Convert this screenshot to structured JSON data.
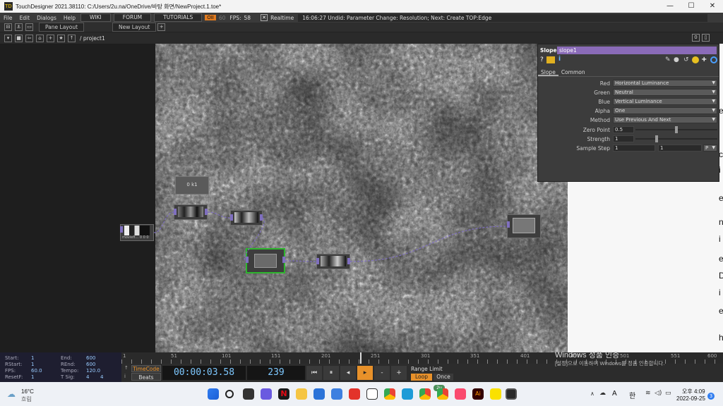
{
  "window": {
    "title": "TouchDesigner 2021.38110: C:/Users/2u.na/OneDrive/바탕 화면/NewProject.1.toe*",
    "minimize": "—",
    "maximize": "☐",
    "close": "✕"
  },
  "menu": {
    "items": [
      "File",
      "Edit",
      "Dialogs",
      "Help"
    ],
    "wiki": "WIKI",
    "forum": "FORUM",
    "tutorials": "TUTORIALS",
    "oii": "OII",
    "fps_target": "60",
    "fps_label": "FPS:",
    "fps_value": "58",
    "realtime_check": "✕",
    "realtime": "Realtime",
    "status": "16:06:27 Undid: Parameter Change: Resolution; Next: Create TOP:Edge"
  },
  "panes": {
    "pane_layout": "Pane Layout",
    "new_layout": "New Layout",
    "add": "+"
  },
  "path": {
    "value": "/ project1",
    "right_zero": "0",
    "right_box": "▯"
  },
  "params": {
    "op_type": "Slope",
    "op_name": "slope1",
    "tabs": [
      "Slope",
      "Common"
    ],
    "rows": [
      {
        "label": "Red",
        "value": "Horizontal Luminance"
      },
      {
        "label": "Green",
        "value": "Neutral"
      },
      {
        "label": "Blue",
        "value": "Vertical Luminance"
      },
      {
        "label": "Alpha",
        "value": "One"
      },
      {
        "label": "Method",
        "value": "Use Previous And Next"
      }
    ],
    "zero_point": {
      "label": "Zero Point",
      "value": "0.5",
      "level": 0.5
    },
    "strength": {
      "label": "Strength",
      "value": "1",
      "level": 0.25
    },
    "sample_step": {
      "label": "Sample Step",
      "v1": "1",
      "v2": "1",
      "p": "P"
    }
  },
  "nodes": {
    "comment": "0 k1",
    "moviefile_label": "moviefi... 0 0 0"
  },
  "stats": {
    "start_l": "Start:",
    "start_v": "1",
    "rstart_l": "RStart:",
    "rstart_v": "1",
    "fps_l": "FPS:",
    "fps_v": "60.0",
    "resetf_l": "ResetF:",
    "resetf_v": "1",
    "end_l": "End:",
    "end_v": "600",
    "rend_l": "REnd:",
    "rend_v": "600",
    "tempo_l": "Tempo:",
    "tempo_v": "120.0",
    "tsig_l": "T Sig:",
    "tsig_v1": "4",
    "tsig_v2": "4"
  },
  "timeline": {
    "ticks": [
      "1",
      "51",
      "101",
      "151",
      "201",
      "251",
      "301",
      "351",
      "401",
      "451",
      "501",
      "551",
      "600"
    ]
  },
  "transport": {
    "timecode": "TimeCode",
    "beats": "Beats",
    "time": "00:00:03.58",
    "frame": "239",
    "range_limit": "Range Limit",
    "loop": "Loop",
    "once": "Once",
    "minus": "-",
    "plus": "+"
  },
  "watermark": {
    "line1": "Windows 정품 인증",
    "line2": "[설정]으로 이동하여 Windows를 정품 인증합니다."
  },
  "right_fragments": [
    "e",
    "c",
    "i",
    "e",
    "n",
    "i",
    "e",
    "D",
    "i",
    "e",
    "h"
  ],
  "taskbar": {
    "temp": "16°C",
    "weather": "흐림",
    "lang": "A",
    "ime": "한",
    "time": "오후 4:09",
    "date": "2022-09-25",
    "badge": "3",
    "chat_badge": "2u"
  }
}
